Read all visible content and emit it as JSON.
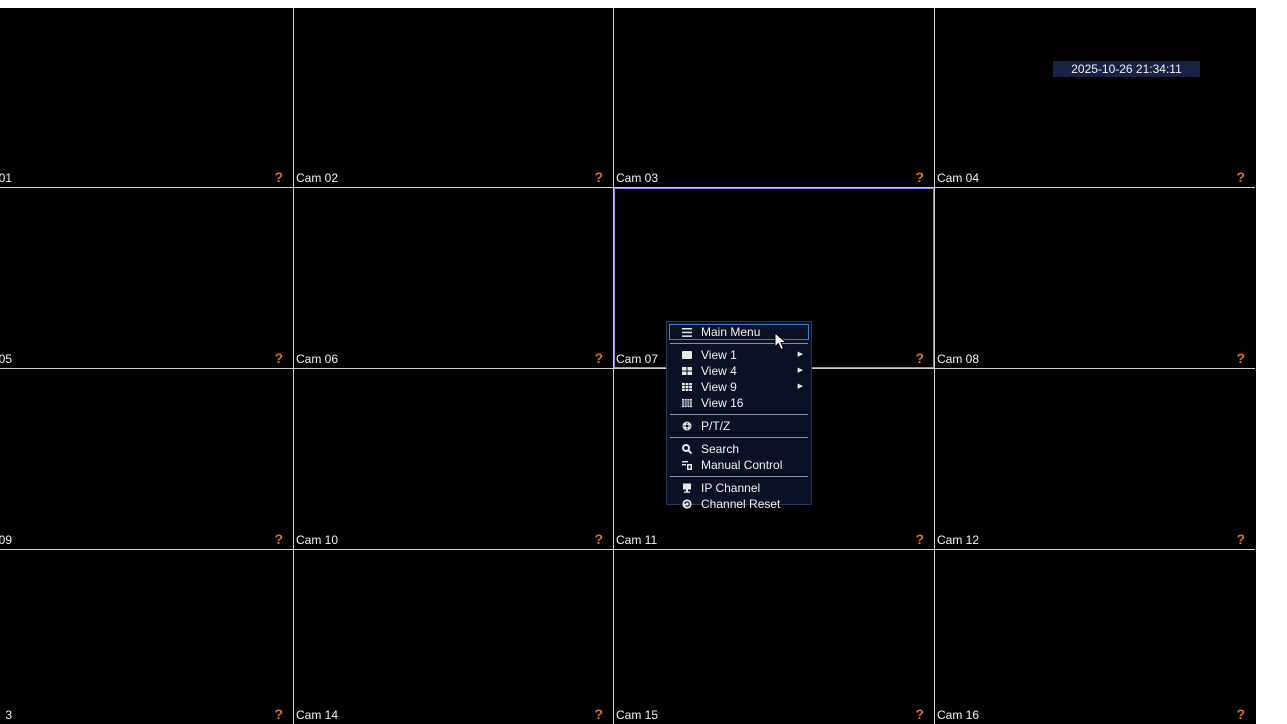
{
  "clock": "2025-10-26 21:34:11",
  "grid": {
    "selected_cell": 6,
    "cells": [
      {
        "label": "01",
        "status": "?"
      },
      {
        "label": "Cam 02",
        "status": "?"
      },
      {
        "label": "Cam 03",
        "status": "?"
      },
      {
        "label": "Cam 04",
        "status": "?"
      },
      {
        "label": "05",
        "status": "?"
      },
      {
        "label": "Cam 06",
        "status": "?"
      },
      {
        "label": "Cam 07",
        "status": "?"
      },
      {
        "label": "Cam 08",
        "status": "?"
      },
      {
        "label": "09",
        "status": "?"
      },
      {
        "label": "Cam 10",
        "status": "?"
      },
      {
        "label": "Cam 11",
        "status": "?"
      },
      {
        "label": "Cam 12",
        "status": "?"
      },
      {
        "label": "3",
        "status": "?"
      },
      {
        "label": "Cam 14",
        "status": "?"
      },
      {
        "label": "Cam 15",
        "status": "?"
      },
      {
        "label": "Cam 16",
        "status": "?"
      }
    ]
  },
  "context_menu": {
    "main_menu": {
      "label": "Main Menu",
      "icon": "menu-icon"
    },
    "views": [
      {
        "label": "View 1",
        "icon": "view-1-icon",
        "has_submenu": true
      },
      {
        "label": "View 4",
        "icon": "view-4-icon",
        "has_submenu": true
      },
      {
        "label": "View 9",
        "icon": "view-9-icon",
        "has_submenu": true
      },
      {
        "label": "View 16",
        "icon": "view-16-icon",
        "has_submenu": false
      }
    ],
    "ptz": {
      "label": "P/T/Z",
      "icon": "ptz-icon"
    },
    "search": {
      "label": "Search",
      "icon": "search-icon"
    },
    "manual_control": {
      "label": "Manual Control",
      "icon": "manual-control-icon"
    },
    "ip_channel": {
      "label": "IP Channel",
      "icon": "ip-channel-icon"
    },
    "channel_reset": {
      "label": "Channel Reset",
      "icon": "channel-reset-icon"
    }
  },
  "colors": {
    "status": "#e0701c",
    "grid_line": "#cfcfcf",
    "selected_border": "#8a86f0",
    "menu_bg": "#0b1124",
    "menu_highlight": "#3f7fd6",
    "clock_bg": "#182347"
  }
}
